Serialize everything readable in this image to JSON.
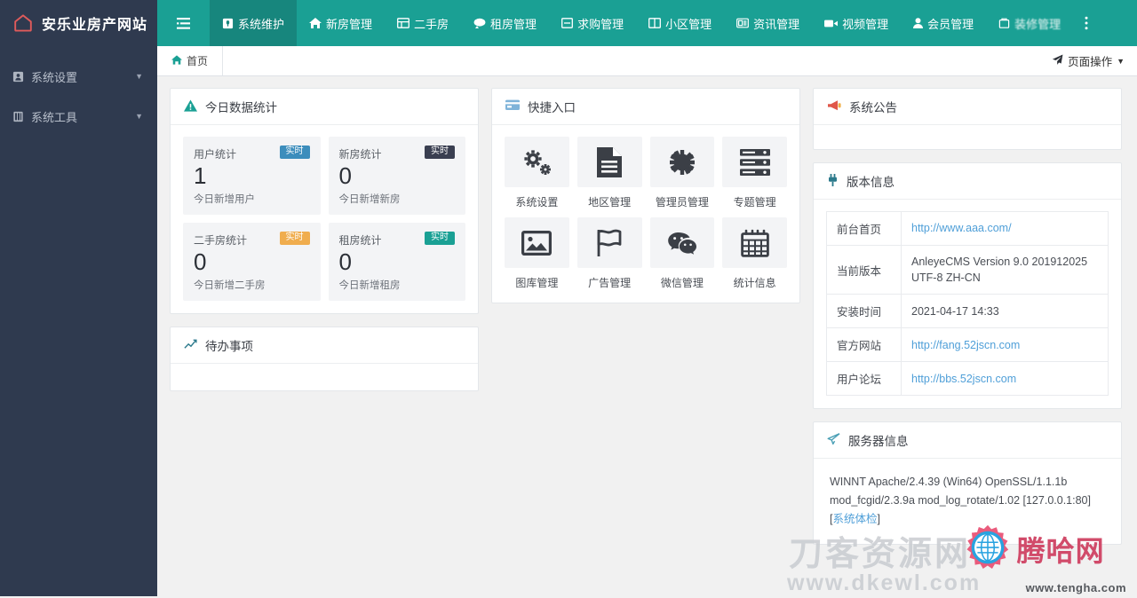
{
  "brand": {
    "title": "安乐业房产网站",
    "logo_icon": "home-icon"
  },
  "topnav": {
    "toggle_icon": "menu-toggle-icon",
    "more_icon": "more-vertical-icon",
    "items": [
      {
        "label": "系统维护",
        "icon": "wrench-icon",
        "active": true
      },
      {
        "label": "新房管理",
        "icon": "building-icon",
        "active": false
      },
      {
        "label": "二手房",
        "icon": "house-swap-icon",
        "active": false
      },
      {
        "label": "租房管理",
        "icon": "key-icon",
        "active": false
      },
      {
        "label": "求购管理",
        "icon": "cart-icon",
        "active": false
      },
      {
        "label": "小区管理",
        "icon": "columns-icon",
        "active": false
      },
      {
        "label": "资讯管理",
        "icon": "news-icon",
        "active": false
      },
      {
        "label": "视频管理",
        "icon": "video-icon",
        "active": false
      },
      {
        "label": "会员管理",
        "icon": "user-icon",
        "active": false
      },
      {
        "label": "装修管理",
        "icon": "paint-icon",
        "active": false,
        "blurred": true
      }
    ]
  },
  "sidebar": {
    "items": [
      {
        "label": "系统设置",
        "icon": "gear-box-icon",
        "caret": "▼"
      },
      {
        "label": "系统工具",
        "icon": "tools-icon",
        "caret": "▼"
      }
    ]
  },
  "tabs": {
    "home_label": "首页",
    "home_icon": "home-icon"
  },
  "page_ops": {
    "label": "页面操作",
    "icon": "paper-plane-icon",
    "caret": "▼"
  },
  "stats_panel": {
    "title": "今日数据统计",
    "icon": "warning-triangle-icon",
    "cards": [
      {
        "title": "用户统计",
        "badge": "实时",
        "badge_color": "blue",
        "value": "1",
        "sub": "今日新增用户"
      },
      {
        "title": "新房统计",
        "badge": "实时",
        "badge_color": "dark",
        "value": "0",
        "sub": "今日新增新房"
      },
      {
        "title": "二手房统计",
        "badge": "实时",
        "badge_color": "orange",
        "value": "0",
        "sub": "今日新增二手房"
      },
      {
        "title": "租房统计",
        "badge": "实时",
        "badge_color": "teal",
        "value": "0",
        "sub": "今日新增租房"
      }
    ]
  },
  "todo_panel": {
    "title": "待办事项",
    "icon": "chart-line-icon"
  },
  "quick_panel": {
    "title": "快捷入口",
    "icon": "credit-card-icon",
    "items": [
      {
        "label": "系统设置",
        "icon": "gears-icon"
      },
      {
        "label": "地区管理",
        "icon": "document-icon"
      },
      {
        "label": "管理员管理",
        "icon": "sun-gear-icon"
      },
      {
        "label": "专题管理",
        "icon": "server-stack-icon"
      },
      {
        "label": "图库管理",
        "icon": "image-icon"
      },
      {
        "label": "广告管理",
        "icon": "flag-icon"
      },
      {
        "label": "微信管理",
        "icon": "wechat-icon"
      },
      {
        "label": "统计信息",
        "icon": "calendar-icon"
      }
    ]
  },
  "notice_panel": {
    "title": "系统公告",
    "icon": "megaphone-icon",
    "body": ""
  },
  "version_panel": {
    "title": "版本信息",
    "icon": "plug-icon",
    "rows": [
      {
        "key": "前台首页",
        "value": "http://www.aaa.com/",
        "is_link": true
      },
      {
        "key": "当前版本",
        "value": "AnleyeCMS Version 9.0 201912025 UTF-8 ZH-CN",
        "is_link": false
      },
      {
        "key": "安装时间",
        "value": "2021-04-17 14:33",
        "is_link": false
      },
      {
        "key": "官方网站",
        "value": "http://fang.52jscn.com",
        "is_link": true
      },
      {
        "key": "用户论坛",
        "value": "http://bbs.52jscn.com",
        "is_link": true
      }
    ]
  },
  "server_panel": {
    "title": "服务器信息",
    "icon": "paper-plane-icon",
    "text": " WINNT Apache/2.4.39 (Win64) OpenSSL/1.1.1b mod_fcgid/2.3.9a mod_log_rotate/1.02 [127.0.0.1:80] [",
    "link_text": "系统体检",
    "text_tail": "]"
  },
  "watermarks": {
    "gray_cn": "刀客资源网",
    "gray_url": "www.dkewl.com",
    "color_cn": "腾哈网",
    "color_url": "www.tengha.com"
  },
  "colors": {
    "brand_dark": "#2f3a4f",
    "teal": "#1aa094",
    "teal_active": "#17867d",
    "link": "#4f9fd8",
    "badge_blue": "#3c8dbc",
    "badge_dark": "#3a3f51",
    "badge_orange": "#f0ad4e",
    "badge_teal": "#1aa094"
  }
}
